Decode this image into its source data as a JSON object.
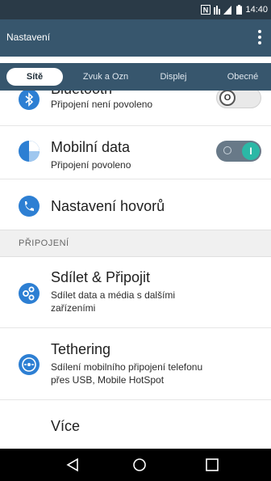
{
  "status_bar": {
    "time": "14:40",
    "icons": [
      "nfc-icon",
      "signal-icon",
      "battery-icon"
    ]
  },
  "app_bar": {
    "title": "Nastavení",
    "menu_icon": "overflow-menu-icon"
  },
  "tabs": [
    {
      "label": "Sítě",
      "active": true
    },
    {
      "label": "Zvuk a Ozn",
      "active": false
    },
    {
      "label": "Displej",
      "active": false
    },
    {
      "label": "Obecné",
      "active": false
    }
  ],
  "items": {
    "bluetooth": {
      "title": "Bluetooth",
      "subtitle": "Připojení není povoleno",
      "icon": "bluetooth-icon",
      "toggle_on": false,
      "toggle_symbol": "O"
    },
    "mobile_data": {
      "title": "Mobilní data",
      "subtitle": "Připojení povoleno",
      "icon": "mobile-data-icon",
      "toggle_on": true,
      "toggle_symbol": "I"
    },
    "calls": {
      "title": "Nastavení hovorů",
      "icon": "phone-icon"
    },
    "section_header": "PŘIPOJENÍ",
    "share": {
      "title": "Sdílet & Připojit",
      "subtitle_line1": "Sdílet data a média s dalšími",
      "subtitle_line2": "zařízeními",
      "icon": "share-connect-icon"
    },
    "tethering": {
      "title": "Tethering",
      "subtitle_line1": "Sdílení mobilního připojení telefonu",
      "subtitle_line2": "přes USB, Mobile HotSpot",
      "icon": "tethering-icon"
    },
    "more": {
      "title": "Více"
    }
  },
  "nav_bar": {
    "buttons": [
      "back-icon",
      "home-icon",
      "recents-icon"
    ]
  },
  "colors": {
    "app_bar": "#37566d",
    "status_bar": "#2a3a47",
    "icon_blue": "#2d7fd3",
    "toggle_green": "#2bb8a6",
    "toggle_off": "#d8d8d8"
  }
}
